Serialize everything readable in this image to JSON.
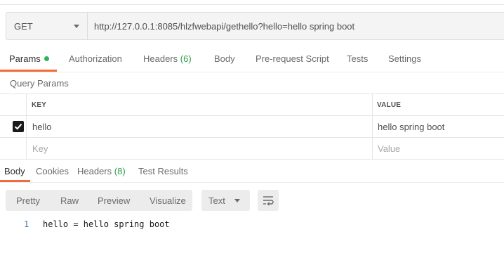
{
  "request": {
    "method": "GET",
    "url": "http://127.0.0.1:8085/hlzfwebapi/gethello?hello=hello spring boot"
  },
  "request_tabs": {
    "params": "Params",
    "authorization": "Authorization",
    "headers": "Headers",
    "headers_count": "(6)",
    "body": "Body",
    "pre_request_script": "Pre-request Script",
    "tests": "Tests",
    "settings": "Settings"
  },
  "query_params": {
    "title": "Query Params",
    "columns": {
      "key": "KEY",
      "value": "VALUE"
    },
    "rows": [
      {
        "checked": true,
        "key": "hello",
        "value": "hello spring boot"
      }
    ],
    "new_row": {
      "key_placeholder": "Key",
      "value_placeholder": "Value"
    }
  },
  "response_tabs": {
    "body": "Body",
    "cookies": "Cookies",
    "headers": "Headers",
    "headers_count": "(8)",
    "test_results": "Test Results"
  },
  "response_toolbar": {
    "pretty": "Pretty",
    "raw": "Raw",
    "preview": "Preview",
    "visualize": "Visualize",
    "format": "Text"
  },
  "response_body": {
    "lines": [
      {
        "number": "1",
        "text": "hello = hello spring boot"
      }
    ]
  },
  "colors": {
    "accent": "#f26b3a",
    "count_green": "#2e9e4f",
    "dot_green": "#2fb35c",
    "line_number_blue": "#3a78b5"
  }
}
